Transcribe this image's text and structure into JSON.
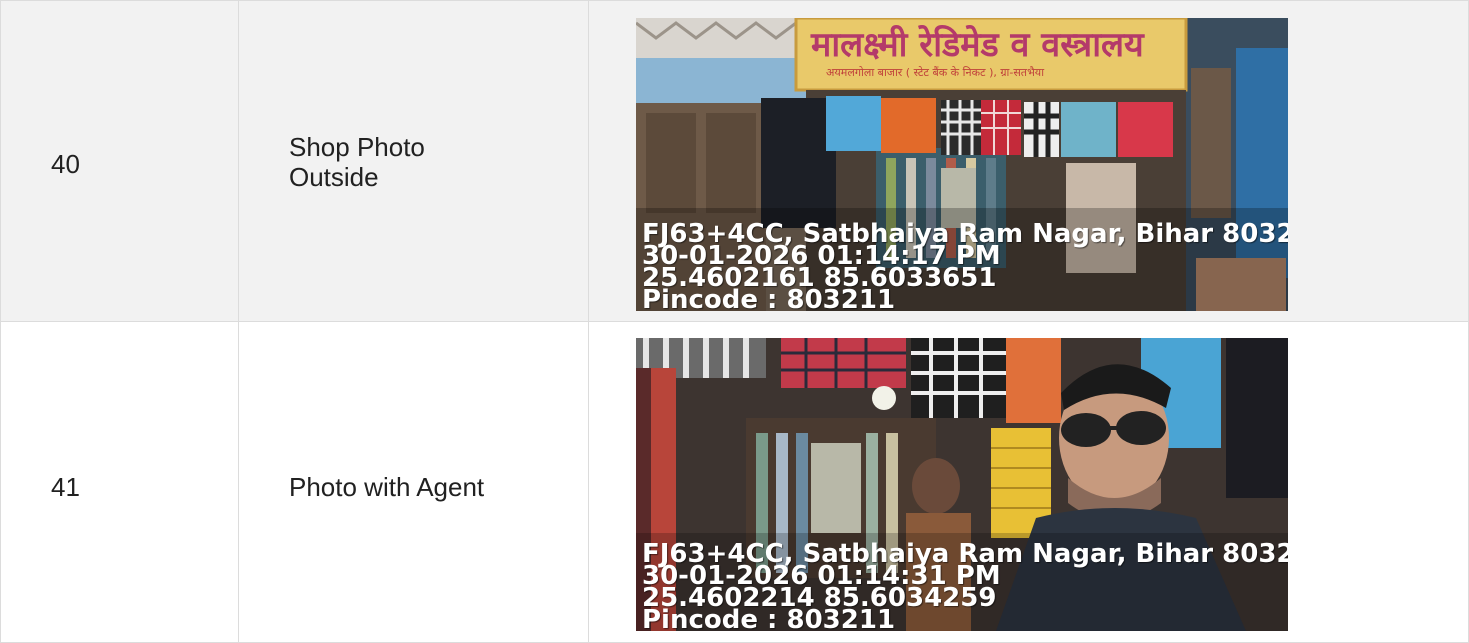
{
  "rows": [
    {
      "number": "40",
      "description": "Shop Photo Outside",
      "photo": {
        "sign_text": "मालक्ष्मी रेडिमेड व वस्त्रालय",
        "sign_subtext": "अयमलगोला बाजार ( स्टेट बैंक के निकट ), ग्रा-सतभैया",
        "stamp": {
          "address": "FJ63+4CC, Satbhaiya Ram Nagar, Bihar 8032",
          "datetime": "30-01-2026 01:14:17 PM",
          "coords": "25.4602161 85.6033651",
          "pincode": "Pincode : 803211"
        }
      }
    },
    {
      "number": "41",
      "description": "Photo with Agent",
      "photo": {
        "stamp": {
          "address": "FJ63+4CC, Satbhaiya Ram Nagar, Bihar 8032",
          "datetime": "30-01-2026 01:14:31 PM",
          "coords": "25.4602214 85.6034259",
          "pincode": "Pincode : 803211"
        }
      }
    }
  ]
}
